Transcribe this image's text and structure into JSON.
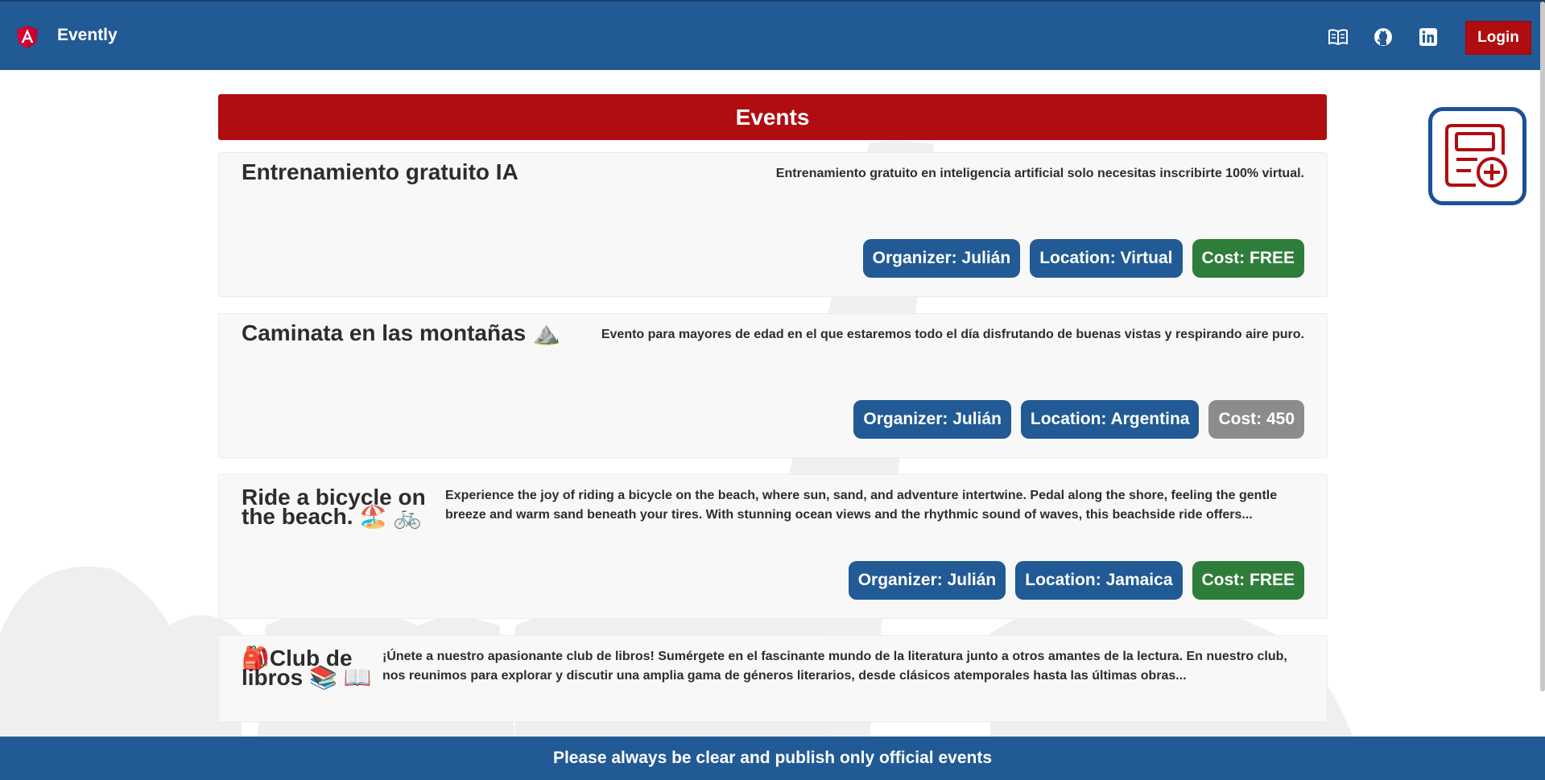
{
  "app": {
    "name": "Evently",
    "logo_icon": "angular-logo-icon"
  },
  "header": {
    "icons": [
      "book-icon",
      "github-icon",
      "linkedin-icon"
    ],
    "login_label": "Login"
  },
  "page": {
    "title": "Events",
    "create_icon": "add-event-icon"
  },
  "events": [
    {
      "title": "Entrenamiento gratuito IA",
      "description": "Entrenamiento gratuito en inteligencia artificial solo necesitas inscribirte 100% virtual.",
      "organizer": "Organizer: Julián",
      "location": "Location: Virtual",
      "cost": "Cost: FREE",
      "cost_color": "#2e7d3a"
    },
    {
      "title": "Caminata en las montañas ⛰️",
      "description": "Evento para mayores de edad en el que estaremos todo el día disfrutando de buenas vistas y respirando aire puro.",
      "organizer": "Organizer: Julián",
      "location": "Location: Argentina",
      "cost": "Cost: 450",
      "cost_color": "#8c8c8c"
    },
    {
      "title_line1": "Ride a bicycle on",
      "title_line2": "the beach. 🏖️ 🚲",
      "description": "Experience the joy of riding a bicycle on the beach, where sun, sand, and adventure intertwine. Pedal along the shore, feeling the gentle breeze and warm sand beneath your tires. With stunning ocean views and the rhythmic sound of waves, this beachside ride offers...",
      "organizer": "Organizer: Julián",
      "location": "Location: Jamaica",
      "cost": "Cost: FREE",
      "cost_color": "#2e7d3a"
    },
    {
      "title_line1": "🎒Club de",
      "title_line2": "libros 📚 📖",
      "description": "¡Únete a nuestro apasionante club de libros! Sumérgete en el fascinante mundo de la literatura junto a otros amantes de la lectura. En nuestro club, nos reunimos para explorar y discutir una amplia gama de géneros literarios, desde clásicos atemporales hasta las últimas obras..."
    }
  ],
  "footer": {
    "text": "Please always be clear and publish only official events"
  },
  "colors": {
    "primary": "#215a94",
    "accent": "#b00d10",
    "free": "#2e7d3a",
    "paid": "#8c8c8c"
  }
}
